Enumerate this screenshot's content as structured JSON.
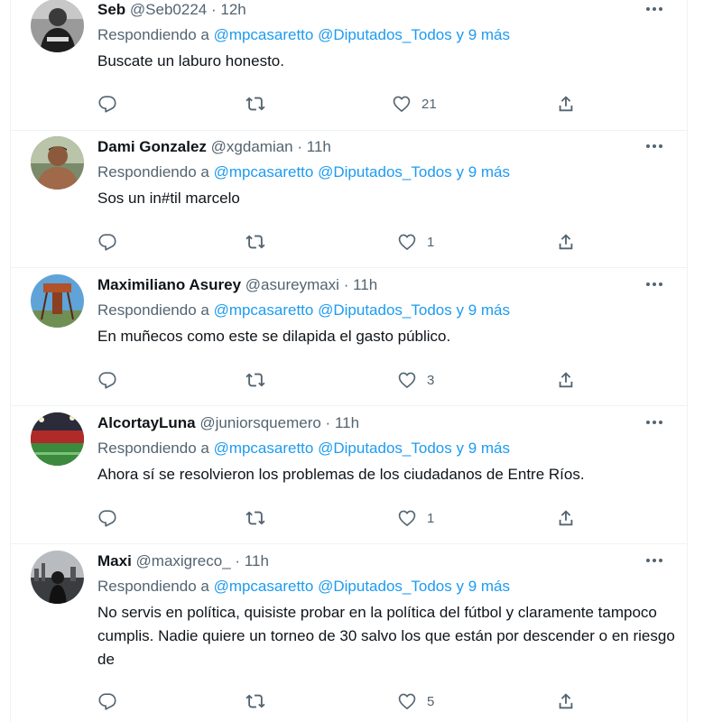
{
  "reply_prefix": "Respondiendo a",
  "icons": {
    "more": "more-horizontal-icon",
    "reply": "reply-icon",
    "retweet": "retweet-icon",
    "like": "heart-icon",
    "share": "share-icon"
  },
  "colors": {
    "mention": "#1d9bf0",
    "secondary_text": "#536471",
    "primary_text": "#0f1419",
    "divider": "#eff3f4"
  },
  "tweets": [
    {
      "name": "Seb",
      "handle": "@Seb0224",
      "time": "12h",
      "mention1": "@mpcasaretto",
      "mention2": "@Diputados_Todos",
      "more_mentions": "y 9 más",
      "text": "Buscate un laburo honesto.",
      "likes": "21"
    },
    {
      "name": "Dami Gonzalez",
      "handle": "@xgdamian",
      "time": "11h",
      "mention1": "@mpcasaretto",
      "mention2": "@Diputados_Todos",
      "more_mentions": "y 9 más",
      "text": "Sos un in#til marcelo",
      "likes": "1"
    },
    {
      "name": "Maximiliano Asurey",
      "handle": "@asureymaxi",
      "time": "11h",
      "mention1": "@mpcasaretto",
      "mention2": "@Diputados_Todos",
      "more_mentions": "y 9 más",
      "text": "En muñecos como este se dilapida el gasto público.",
      "likes": "3"
    },
    {
      "name": "AlcortayLuna",
      "handle": "@juniorsquemero",
      "time": "11h",
      "mention1": "@mpcasaretto",
      "mention2": "@Diputados_Todos",
      "more_mentions": "y 9 más",
      "text": "Ahora sí se resolvieron los problemas de los ciudadanos de Entre Ríos.",
      "likes": "1"
    },
    {
      "name": "Maxi",
      "handle": "@maxigreco_",
      "time": "11h",
      "mention1": "@mpcasaretto",
      "mention2": "@Diputados_Todos",
      "more_mentions": "y 9 más",
      "text": "No servis en política, quisiste probar en la política del fútbol y claramente tampoco cumplis. Nadie quiere un torneo de 30 salvo los que están por descender o en riesgo de",
      "likes": "5"
    }
  ]
}
